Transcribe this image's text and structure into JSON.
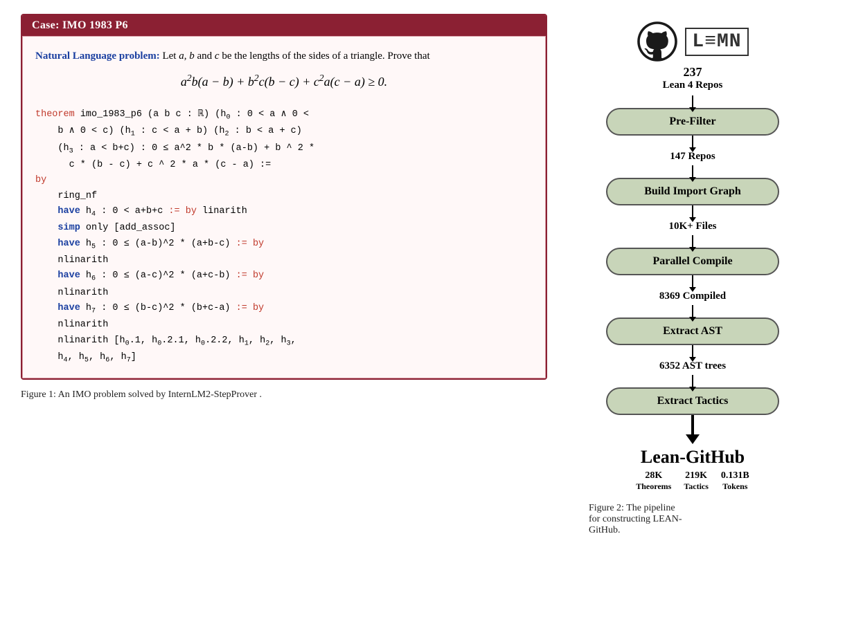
{
  "left": {
    "case_header": "Case: IMO 1983 P6",
    "nl_label": "Natural Language problem:",
    "nl_text": " Let a, b and c be the lengths of the sides of a triangle. Prove that",
    "math_formula": "a²b(a − b) + b²c(b − c) + c²a(c − a) ≥ 0.",
    "code_lines": [
      {
        "type": "theorem_line1",
        "text": "theorem imo_1983_p6 (a b c : ℝ) (h₀ : 0 < a ∧ 0 <"
      },
      {
        "type": "cont",
        "text": "    b ∧ 0 < c) (h₁ : c < a + b) (h₂ : b < a + c)"
      },
      {
        "type": "cont",
        "text": "    (h₃ : a < b+c) : 0 ≤ a^2 * b * (a-b) + b ^ 2 *"
      },
      {
        "type": "cont",
        "text": "      c * (b - c) + c ^ 2 * a * (c - a) :="
      },
      {
        "type": "by",
        "text": "by"
      },
      {
        "type": "tactic",
        "text": "    ring_nf"
      },
      {
        "type": "tactic_have",
        "text": "    have h₄ : 0 < a+b+c := by linarith"
      },
      {
        "type": "tactic_simp",
        "text": "    simp only [add_assoc]"
      },
      {
        "type": "tactic_have",
        "text": "    have h₅ : 0 ≤ (a-b)^2 * (a+b-c) := by"
      },
      {
        "type": "tactic_nl",
        "text": "    nlinarith"
      },
      {
        "type": "tactic_have",
        "text": "    have h₆ : 0 ≤ (a-c)^2 * (a+c-b) := by"
      },
      {
        "type": "tactic_nl",
        "text": "    nlinarith"
      },
      {
        "type": "tactic_have",
        "text": "    have h₇ : 0 ≤ (b-c)^2 * (b+c-a) := by"
      },
      {
        "type": "tactic_nl",
        "text": "    nlinarith"
      },
      {
        "type": "tactic_final",
        "text": "    nlinarith [h₀.1, h₀.2.1, h₀.2.2, h₁, h₂, h₃,"
      },
      {
        "type": "tactic_final2",
        "text": "    h₄, h₅, h₆, h₇]"
      }
    ],
    "figure_caption": "Figure 1: An IMO problem solved by InternLM2-StepProver ."
  },
  "right": {
    "repos_count": "237",
    "repos_label": "Lean 4 Repos",
    "lean_logo_text": "L≡MN",
    "boxes": [
      {
        "id": "prefilter",
        "label": "Pre-Filter"
      },
      {
        "id": "import_graph",
        "label": "Build Import Graph"
      },
      {
        "id": "parallel_compile",
        "label": "Parallel Compile"
      },
      {
        "id": "extract_ast",
        "label": "Extract AST"
      },
      {
        "id": "extract_tactics",
        "label": "Extract Tactics"
      }
    ],
    "labels_between": [
      "147 Repos",
      "10K+ Files",
      "8369 Compiled",
      "6352 AST trees"
    ],
    "final_title": "Lean-GitHub",
    "stats": [
      {
        "value": "28K",
        "label": "Theorems"
      },
      {
        "value": "219K",
        "label": "Tactics"
      },
      {
        "value": "0.131B",
        "label": "Tokens"
      }
    ],
    "figure_caption_line1": "Figure 2:   The pipeline",
    "figure_caption_line2": "for  constructing  LEAN-",
    "figure_caption_line3": "GitHub."
  }
}
